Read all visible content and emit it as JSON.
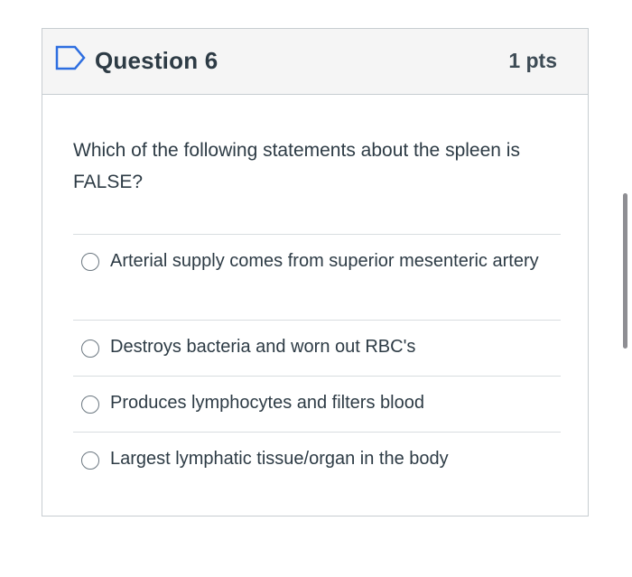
{
  "question": {
    "title": "Question 6",
    "points": "1 pts",
    "text": "Which of the following statements about the spleen is FALSE?",
    "answers": [
      {
        "label": "Arterial supply comes from superior mesenteric artery"
      },
      {
        "label": "Destroys bacteria and worn out RBC's"
      },
      {
        "label": "Produces lymphocytes and filters blood"
      },
      {
        "label": "Largest lymphatic tissue/organ in the body"
      }
    ]
  },
  "icons": {
    "bookmark": "bookmark-flag-icon"
  },
  "colors": {
    "accent": "#2d6ee0",
    "text": "#2d3b45",
    "header_bg": "#f5f5f5",
    "border": "#c7cdd1"
  }
}
